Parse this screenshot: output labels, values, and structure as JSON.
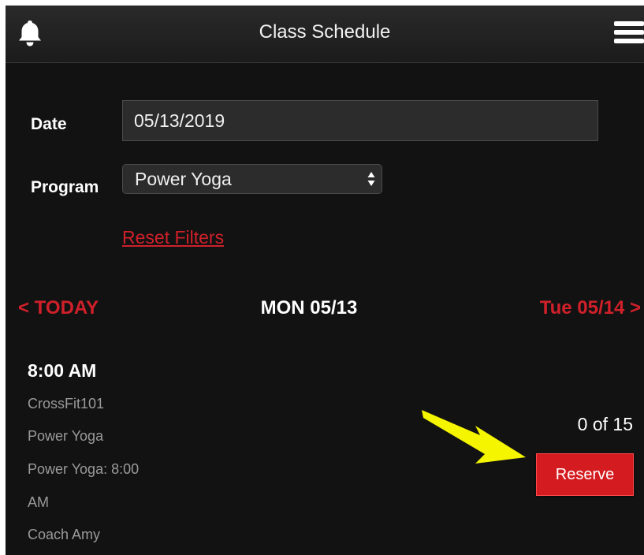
{
  "header": {
    "title": "Class Schedule",
    "left_icon": "bell-icon",
    "right_icon": "hamburger-menu-icon"
  },
  "filters": {
    "date_label": "Date",
    "date_value": "05/13/2019",
    "program_label": "Program",
    "program_value": "Power Yoga",
    "reset_label": "Reset Filters"
  },
  "day_nav": {
    "prev_label": "< TODAY",
    "current_label": "MON 05/13",
    "next_label": "Tue 05/14 >"
  },
  "class_item": {
    "time": "8:00 AM",
    "details": [
      "CrossFit101",
      "Power Yoga",
      "Power Yoga: 8:00",
      "AM",
      "Coach Amy"
    ],
    "capacity": "0 of 15",
    "reserve_label": "Reserve"
  },
  "colors": {
    "background": "#121212",
    "accent_red": "#d0202a",
    "annotation_arrow": "#f5f500"
  }
}
